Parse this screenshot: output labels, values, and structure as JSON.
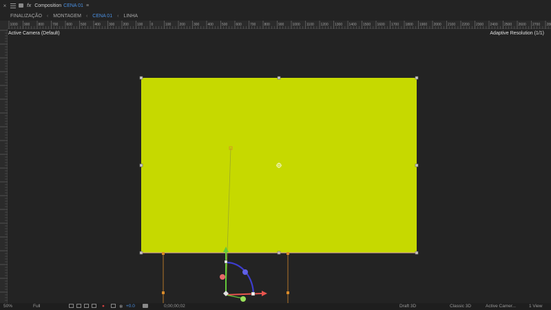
{
  "titlebar": {
    "close": "×",
    "comp_label": "Composition",
    "comp_name": "CENA 01",
    "menu": "≡"
  },
  "breadcrumbs": {
    "items": [
      {
        "label": "FINALIZAÇÃO",
        "active": false
      },
      {
        "label": "MONTAGEM",
        "active": false
      },
      {
        "label": "CENA 01",
        "active": true
      },
      {
        "label": "LINHA",
        "active": false
      }
    ],
    "separator": "‹"
  },
  "ruler": {
    "labels": [
      "1000",
      "900",
      "800",
      "700",
      "600",
      "500",
      "400",
      "300",
      "200",
      "100",
      "0",
      "100",
      "200",
      "300",
      "400",
      "500",
      "600",
      "700",
      "800",
      "900",
      "1000",
      "1100",
      "1200",
      "1300",
      "1400",
      "1500",
      "1600",
      "1700",
      "1800",
      "1900",
      "2000",
      "2100",
      "2200",
      "2300",
      "2400",
      "2500",
      "2600",
      "2700",
      "2800"
    ]
  },
  "viewer": {
    "camera_label": "Active Camera (Default)",
    "resolution_label": "Adaptive Resolution (1/1)"
  },
  "layer": {
    "color": "#c6d900"
  },
  "statusbar": {
    "zoom": "50%",
    "resolution": "Full",
    "exposure": "+0.0",
    "timecode": "0;00;00;02",
    "renderer": "Draft 3D",
    "renderer_type": "Classic 3D",
    "camera": "Active Camer...",
    "views": "1 View"
  },
  "colors": {
    "accent": "#4a90e2",
    "x_axis": "#e8554e",
    "y_axis": "#63c93a",
    "z_axis": "#3d3dd0",
    "handle": "#d88a2a"
  }
}
